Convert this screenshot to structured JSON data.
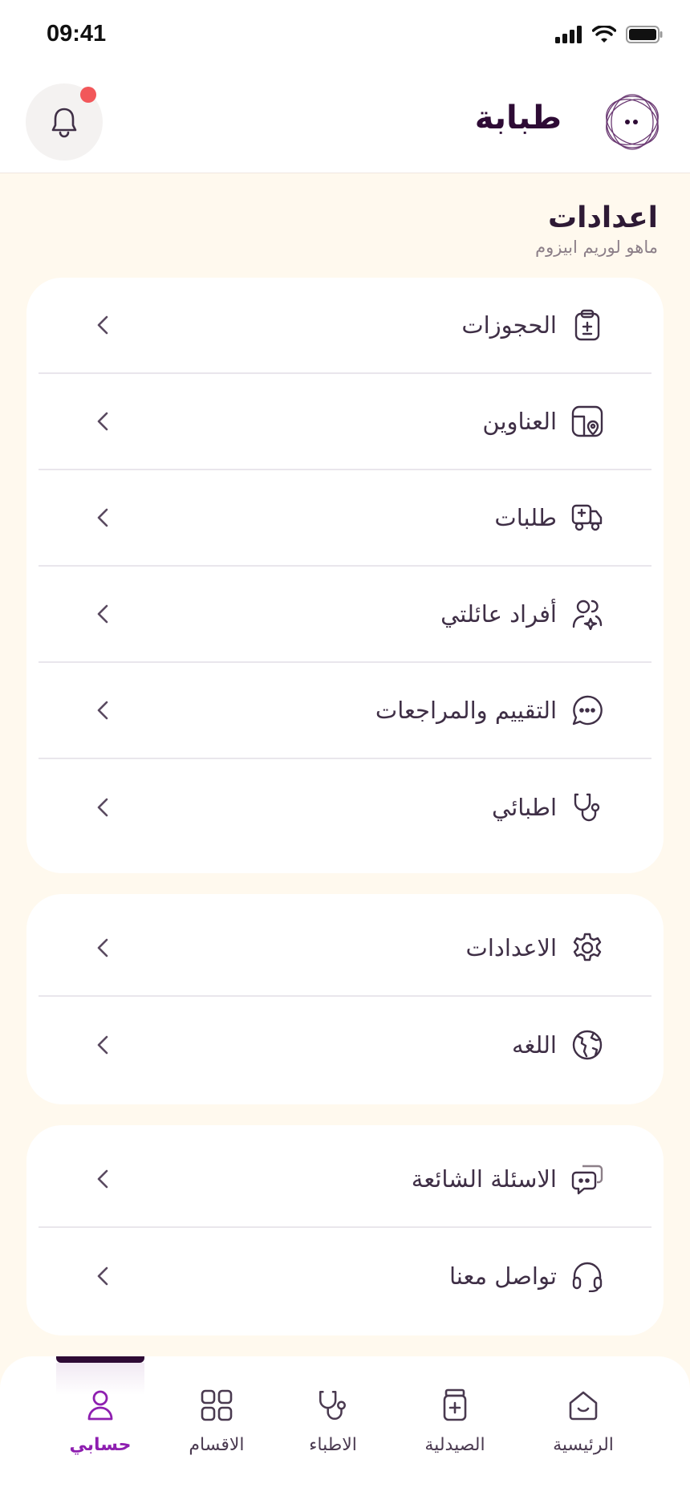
{
  "status_bar": {
    "time": "09:41"
  },
  "header": {
    "brand": "طبابة"
  },
  "page": {
    "title": "اعدادات",
    "subtitle": "ماهو لوريم ابيزوم"
  },
  "menu_groups": [
    {
      "items": [
        {
          "label": "الحجوزات",
          "icon": "booking-clipboard-icon"
        },
        {
          "label": "العناوين",
          "icon": "address-map-icon"
        },
        {
          "label": "طلبات",
          "icon": "delivery-truck-icon"
        },
        {
          "label": "أفراد عائلتي",
          "icon": "family-members-icon"
        },
        {
          "label": "التقييم والمراجعات",
          "icon": "chat-review-icon"
        },
        {
          "label": "اطبائي",
          "icon": "stethoscope-icon"
        }
      ]
    },
    {
      "items": [
        {
          "label": "الاعدادات",
          "icon": "gear-icon"
        },
        {
          "label": "اللغه",
          "icon": "globe-icon"
        }
      ]
    },
    {
      "items": [
        {
          "label": "الاسئلة الشائعة",
          "icon": "faq-chat-icon"
        },
        {
          "label": "تواصل معنا",
          "icon": "headset-icon"
        }
      ]
    }
  ],
  "tabbar": {
    "tabs": [
      {
        "label": "حسابي",
        "icon": "user-icon",
        "active": true
      },
      {
        "label": "الاقسام",
        "icon": "categories-icon",
        "active": false
      },
      {
        "label": "الاطباء",
        "icon": "stethoscope-icon",
        "active": false
      },
      {
        "label": "الصيدلية",
        "icon": "pharmacy-icon",
        "active": false
      },
      {
        "label": "الرئيسية",
        "icon": "home-icon",
        "active": false
      }
    ]
  },
  "colors": {
    "brand": "#2E0B35",
    "accent": "#8E1FB0",
    "background": "#FFF9EE",
    "notification": "#F2575A"
  }
}
